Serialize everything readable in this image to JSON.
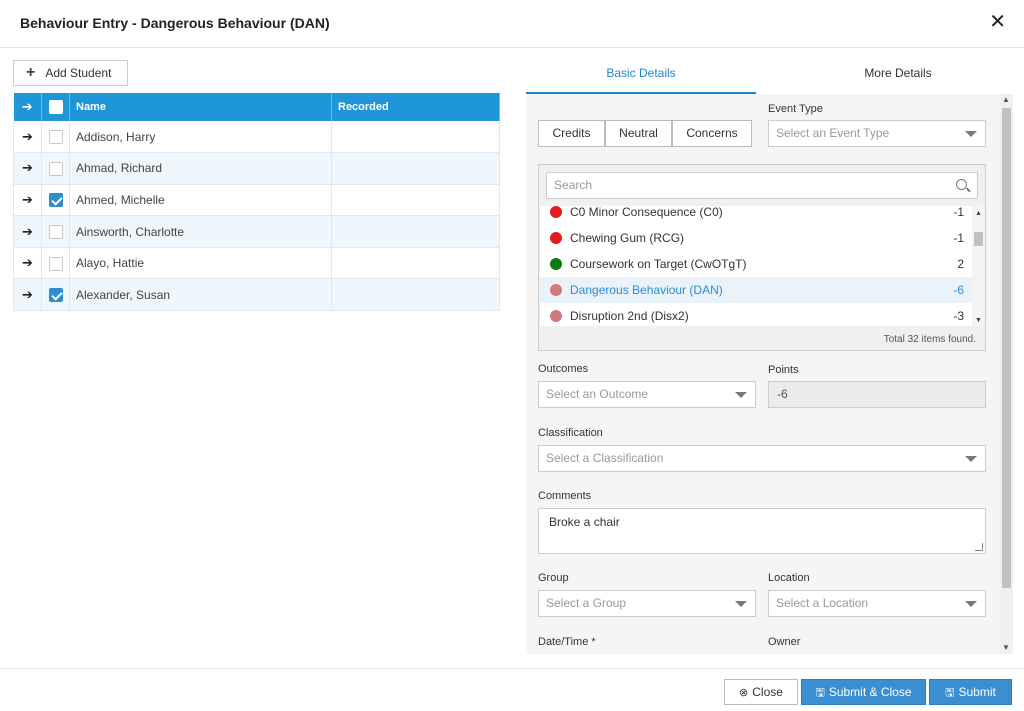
{
  "dialog": {
    "title": "Behaviour Entry - Dangerous Behaviour (DAN)"
  },
  "left": {
    "add_student_label": "Add Student",
    "columns": {
      "name": "Name",
      "recorded": "Recorded"
    },
    "students": [
      {
        "name": "Addison, Harry",
        "checked": false,
        "recorded": ""
      },
      {
        "name": "Ahmad, Richard",
        "checked": false,
        "recorded": ""
      },
      {
        "name": "Ahmed, Michelle",
        "checked": true,
        "recorded": ""
      },
      {
        "name": "Ainsworth, Charlotte",
        "checked": false,
        "recorded": ""
      },
      {
        "name": "Alayo, Hattie",
        "checked": false,
        "recorded": ""
      },
      {
        "name": "Alexander, Susan",
        "checked": true,
        "recorded": ""
      }
    ]
  },
  "tabs": {
    "basic": "Basic Details",
    "more": "More Details"
  },
  "form": {
    "segments": {
      "credits": "Credits",
      "neutral": "Neutral",
      "concerns": "Concerns"
    },
    "event_type": {
      "label": "Event Type",
      "placeholder": "Select an Event Type"
    },
    "search_placeholder": "Search",
    "events": [
      {
        "label": "C0 Minor Consequence (C0)",
        "points": "-1",
        "color": "#e31b1b"
      },
      {
        "label": "Chewing Gum (RCG)",
        "points": "-1",
        "color": "#e31b1b"
      },
      {
        "label": "Coursework on Target (CwOTgT)",
        "points": "2",
        "color": "#0a7d0a"
      },
      {
        "label": "Dangerous Behaviour (DAN)",
        "points": "-6",
        "color": "#d27a7a"
      },
      {
        "label": "Disruption 2nd (Disx2)",
        "points": "-3",
        "color": "#d27a7a"
      }
    ],
    "total_text": "Total 32 items found.",
    "outcomes": {
      "label": "Outcomes",
      "placeholder": "Select an Outcome"
    },
    "points": {
      "label": "Points",
      "value": "-6"
    },
    "classification": {
      "label": "Classification",
      "placeholder": "Select a Classification"
    },
    "comments": {
      "label": "Comments",
      "value": "Broke a chair"
    },
    "group": {
      "label": "Group",
      "placeholder": "Select a Group"
    },
    "location": {
      "label": "Location",
      "placeholder": "Select a Location"
    },
    "datetime": {
      "label": "Date/Time *"
    },
    "owner": {
      "label": "Owner"
    }
  },
  "footer": {
    "close_label": "Close",
    "submit_close_label": "Submit & Close",
    "submit_label": "Submit"
  }
}
